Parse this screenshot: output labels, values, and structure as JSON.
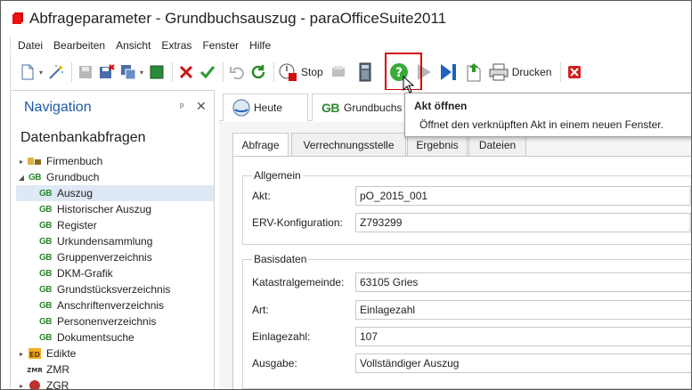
{
  "window": {
    "title": "Abfrageparameter - Grundbuchsauszug - paraOfficeSuite2011"
  },
  "menu": [
    "Datei",
    "Bearbeiten",
    "Ansicht",
    "Extras",
    "Fenster",
    "Hilfe"
  ],
  "toolbar": {
    "stop_label": "Stop",
    "print_label": "Drucken"
  },
  "tooltip": {
    "title": "Akt öffnen",
    "description": "Öffnet den verknüpften Akt in einem neuen Fenster."
  },
  "nav": {
    "title": "Navigation",
    "pin_glyph": "ᵖ",
    "close_glyph": "✕",
    "subtitle": "Datenbankabfragen",
    "tree": [
      {
        "label": "Firmenbuch",
        "level": 0,
        "expander": "▸",
        "icon": "firmenbuch-icon"
      },
      {
        "label": "Grundbuch",
        "level": 0,
        "expander": "◢",
        "icon": "gb-icon"
      },
      {
        "label": "Auszug",
        "level": 1,
        "icon": "gb-icon",
        "selected": true
      },
      {
        "label": "Historischer Auszug",
        "level": 1,
        "icon": "gb-icon"
      },
      {
        "label": "Register",
        "level": 1,
        "icon": "gb-icon"
      },
      {
        "label": "Urkundensammlung",
        "level": 1,
        "icon": "gb-icon"
      },
      {
        "label": "Gruppenverzeichnis",
        "level": 1,
        "icon": "gb-icon"
      },
      {
        "label": "DKM-Grafik",
        "level": 1,
        "icon": "gb-icon"
      },
      {
        "label": "Grundstücksverzeichnis",
        "level": 1,
        "icon": "gb-icon"
      },
      {
        "label": "Anschriftenverzeichnis",
        "level": 1,
        "icon": "gb-icon"
      },
      {
        "label": "Personenverzeichnis",
        "level": 1,
        "icon": "gb-icon"
      },
      {
        "label": "Dokumentsuche",
        "level": 1,
        "icon": "gb-icon"
      },
      {
        "label": "Edikte",
        "level": 0,
        "expander": "▸",
        "icon": "edikte-icon"
      },
      {
        "label": "ZMR",
        "level": 0,
        "icon": "zmr-icon"
      },
      {
        "label": "ZGR",
        "level": 0,
        "expander": "▸",
        "icon": "zgr-icon"
      }
    ]
  },
  "doc_tabs": [
    {
      "label": "Heute",
      "icon": "heute-icon"
    },
    {
      "label": "Grundbuchs",
      "icon": "gb-icon"
    }
  ],
  "gb_glyph": "GB",
  "form_tabs": [
    "Abfrage",
    "Verrechnungsstelle",
    "Ergebnis",
    "Dateien"
  ],
  "groups": {
    "allgemein": {
      "title": "Allgemein",
      "fields": [
        {
          "label": "Akt:",
          "value": "pO_2015_001"
        },
        {
          "label": "ERV-Konfiguration:",
          "value": "Z793299"
        }
      ]
    },
    "basisdaten": {
      "title": "Basisdaten",
      "fields": [
        {
          "label": "Katastralgemeinde:",
          "value": "63105 Gries"
        },
        {
          "label": "Art:",
          "value": "Einlagezahl"
        },
        {
          "label": "Einlagezahl:",
          "value": "107"
        },
        {
          "label": "Ausgabe:",
          "value": "Vollständiger Auszug"
        }
      ]
    }
  },
  "colors": {
    "nav_title": "#1e5aa8",
    "gb_icon": "#2b8a2b",
    "highlight_box": "#d40000",
    "selection": "#dfe9f5"
  }
}
